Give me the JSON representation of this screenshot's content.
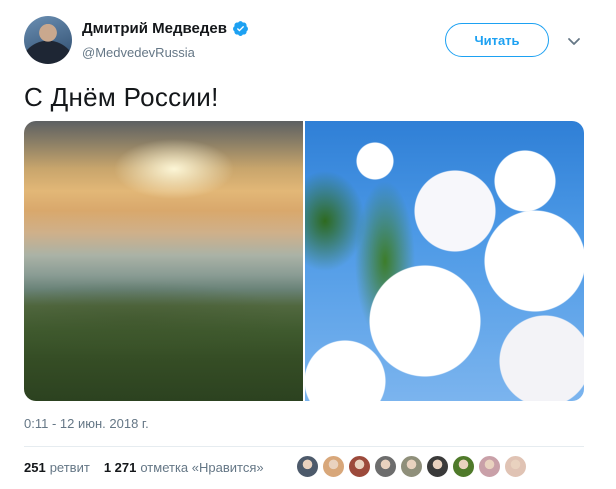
{
  "author": {
    "display_name": "Дмитрий Медведев",
    "handle": "@MedvedevRussia",
    "verified_icon": "verified-badge-icon",
    "follow_label": "Читать"
  },
  "tweet": {
    "text": "С Днём России!",
    "timestamp": "0:11 - 12 июн. 2018 г."
  },
  "stats": {
    "retweets_count": "251",
    "retweets_label": "ретвит",
    "likes_count": "1 271",
    "likes_label": "отметка «Нравится»"
  },
  "colors": {
    "accent": "#1da1f2",
    "text": "#14171a",
    "muted": "#657786"
  },
  "likers": [
    {
      "color": "#4d5a6b"
    },
    {
      "color": "#d8a77a"
    },
    {
      "color": "#9c4a3b"
    },
    {
      "color": "#6d6d6d"
    },
    {
      "color": "#8f8f7a"
    },
    {
      "color": "#3a3a3a"
    },
    {
      "color": "#4f7a2a"
    },
    {
      "color": "#c9a0a8"
    },
    {
      "color": "#e0c3b4"
    }
  ]
}
